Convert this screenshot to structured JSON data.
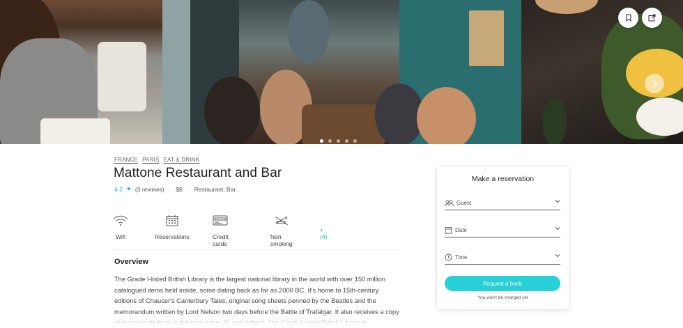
{
  "breadcrumbs": [
    "FRANCE",
    "PARIS",
    "EAT & DRINK"
  ],
  "listing": {
    "title": "Mattone Restaurant and Bar",
    "rating": "4.2",
    "reviews": "(3 reviews)",
    "price": "$$",
    "category": "Restaurant, Bar"
  },
  "amenities": [
    {
      "label": "Wifi",
      "icon": "wifi-icon"
    },
    {
      "label": "Reservations",
      "icon": "calendar-icon"
    },
    {
      "label": "Credit cards",
      "icon": "credit-card-icon"
    },
    {
      "label": "Non smoking",
      "icon": "no-smoking-icon"
    }
  ],
  "amenities_more": "+(4)",
  "overview": {
    "heading": "Overview",
    "text": "The Grade I-listed British Library is the largest national library in the world with over 150 million catalogued items held inside, some dating back as far as 2000 BC. It's home to 15th-century editions of Chaucer's Canterbury Tales, original song sheets penned by the Beatles and the memorandum written by Lord Nelson two days before the Battle of Trafalgar. It also receives a copy of every single book published in the UK and Ireland. The Grade I-listed British Library is"
  },
  "reservation": {
    "title": "Make a reservation",
    "fields": [
      {
        "label": "Guest",
        "icon": "guests-icon"
      },
      {
        "label": "Date",
        "icon": "calendar-icon"
      },
      {
        "label": "Time",
        "icon": "clock-icon"
      }
    ],
    "button": "Request a book",
    "note": "You won't be charged yet"
  },
  "gallery": {
    "slides": 5,
    "active_slide": 1
  },
  "colors": {
    "accent": "#26d0d6",
    "rating": "#1bb6c5"
  }
}
